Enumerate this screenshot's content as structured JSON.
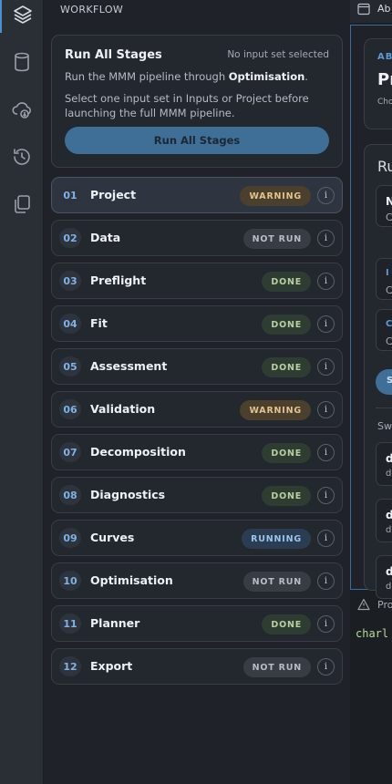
{
  "rail": {
    "items": [
      {
        "name": "layers-icon",
        "active": true
      },
      {
        "name": "database-icon",
        "active": false
      },
      {
        "name": "cloud-download-icon",
        "active": false
      },
      {
        "name": "history-icon",
        "active": false
      },
      {
        "name": "copy-icon",
        "active": false
      }
    ]
  },
  "panel": {
    "title": "WORKFLOW"
  },
  "run_card": {
    "title": "Run All Stages",
    "status": "No input set selected",
    "line1_prefix": "Run the MMM pipeline through ",
    "line1_target": "Optimisation",
    "line1_suffix": ".",
    "line2": "Select one input set in Inputs or Project before launching the full MMM pipeline.",
    "button_label": "Run All Stages"
  },
  "stages": [
    {
      "num": "01",
      "name": "Project",
      "status": "WARNING",
      "kind": "warning",
      "active": true
    },
    {
      "num": "02",
      "name": "Data",
      "status": "NOT RUN",
      "kind": "notrun"
    },
    {
      "num": "03",
      "name": "Preflight",
      "status": "DONE",
      "kind": "done"
    },
    {
      "num": "04",
      "name": "Fit",
      "status": "DONE",
      "kind": "done"
    },
    {
      "num": "05",
      "name": "Assessment",
      "status": "DONE",
      "kind": "done"
    },
    {
      "num": "06",
      "name": "Validation",
      "status": "WARNING",
      "kind": "warning"
    },
    {
      "num": "07",
      "name": "Decomposition",
      "status": "DONE",
      "kind": "done"
    },
    {
      "num": "08",
      "name": "Diagnostics",
      "status": "DONE",
      "kind": "done"
    },
    {
      "num": "09",
      "name": "Curves",
      "status": "RUNNING",
      "kind": "running"
    },
    {
      "num": "10",
      "name": "Optimisation",
      "status": "NOT RUN",
      "kind": "notrun"
    },
    {
      "num": "11",
      "name": "Planner",
      "status": "DONE",
      "kind": "done"
    },
    {
      "num": "12",
      "name": "Export",
      "status": "NOT RUN",
      "kind": "notrun"
    }
  ],
  "info_glyph": "i",
  "editor": {
    "tab_label": "Ab",
    "card1": {
      "kicker": "AB",
      "big": "Pr",
      "small": "Cho"
    },
    "card2": {
      "head": "Ru",
      "mini": [
        {
          "a": "N",
          "b": "C"
        },
        {
          "a": "I",
          "b": "C"
        },
        {
          "a": "C",
          "b": "C"
        }
      ],
      "pill": "S",
      "swap_label": "Sw",
      "mini2": [
        {
          "a": "d",
          "b": "d"
        },
        {
          "a": "d",
          "b": "d"
        },
        {
          "a": "d",
          "b": "d"
        }
      ]
    },
    "problems_label": "Pro",
    "code_text": "charl"
  },
  "colors": {
    "accent": "#4d8fcf",
    "warning_bg": "#4b3f2d",
    "done_bg": "#2f3c31",
    "running_bg": "#2b3d53"
  }
}
